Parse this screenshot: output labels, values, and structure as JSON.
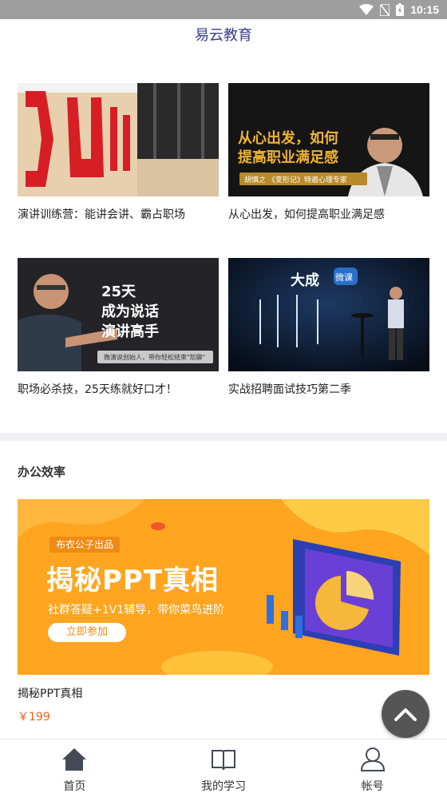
{
  "status_bar": {
    "time": "10:15"
  },
  "app": {
    "title": "易云教育"
  },
  "courses": [
    {
      "title": "演讲训练营：能讲会讲、霸占职场"
    },
    {
      "title": "从心出发，如何提高职业满足感",
      "thumb_line1": "从心出发，如何",
      "thumb_line2": "提高职业满足感",
      "thumb_caption": "胡慎之 《变形记》特邀心理专家"
    },
    {
      "title": "职场必杀技，25天练就好口才！",
      "thumb_line1": "25天",
      "thumb_line2": "成为说话",
      "thumb_line3": "演讲高手",
      "thumb_caption": "微演说创始人，带你轻松结束\"尬聊\""
    },
    {
      "title": "实战招聘面试技巧第二季",
      "thumb_logo": "大成",
      "thumb_logo_tag": "微课"
    }
  ],
  "section": {
    "title": "办公效率"
  },
  "featured": {
    "banner_tag": "布衣公子出品",
    "banner_headline": "揭秘PPT真相",
    "banner_sub": "社群答疑+1V1辅导，带你菜鸟进阶",
    "banner_button": "立即参加",
    "title": "揭秘PPT真相",
    "price": "￥199"
  },
  "bottom_nav": [
    {
      "label": "首页",
      "icon": "home-icon"
    },
    {
      "label": "我的学习",
      "icon": "book-icon"
    },
    {
      "label": "帐号",
      "icon": "user-icon"
    }
  ],
  "colors": {
    "accent": "#3b3b8a",
    "price": "#f0601f",
    "banner": "#ffa51f"
  }
}
